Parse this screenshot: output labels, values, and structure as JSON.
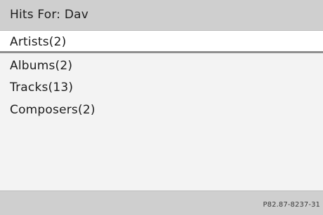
{
  "header": {
    "title": "Hits For: Dav"
  },
  "results": {
    "items": [
      {
        "label": "Artists(2)",
        "selected": true
      },
      {
        "label": "Albums(2)",
        "selected": false
      },
      {
        "label": "Tracks(13)",
        "selected": false
      },
      {
        "label": "Composers(2)",
        "selected": false
      }
    ]
  },
  "footer": {
    "code": "P82.87-8237-31"
  },
  "colors": {
    "header_bg": "#cfcfcf",
    "list_bg": "#f3f3f3",
    "selected_bg": "#ffffff",
    "selected_underline": "#8f8f8f",
    "text": "#1c1c1c"
  }
}
